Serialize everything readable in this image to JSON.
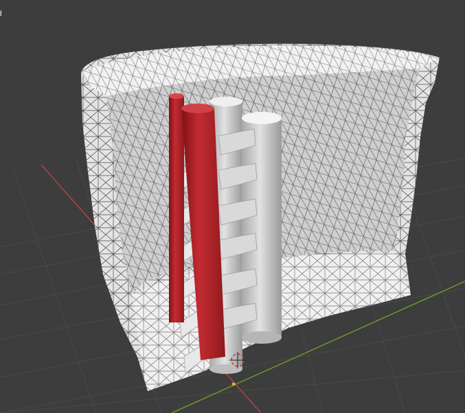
{
  "viewport": {
    "corner_label": "d",
    "colors": {
      "background": "#3d3d3d",
      "grid": "#4a4a4a",
      "x_axis": "#b8434a",
      "y_axis": "#6e9d2e",
      "mesh_fill": "#e9e9e9",
      "wire": "#161616",
      "cylinder": "#cfcfcf",
      "red_element": "#b5242a",
      "origin": "#f0a830"
    },
    "icons": [
      "3d-cursor-icon",
      "origin-point-icon"
    ]
  }
}
